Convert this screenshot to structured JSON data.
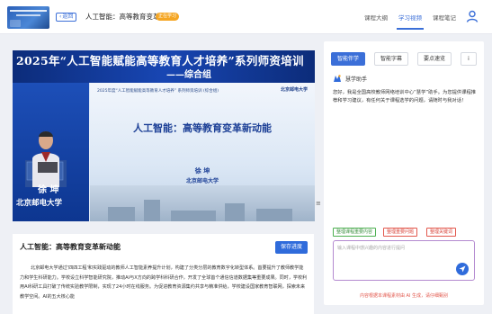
{
  "header": {
    "back_label": "返回",
    "course_title": "人工智能：高等教育变革...",
    "status": "正在学习",
    "tabs": [
      {
        "label": "课程大纲",
        "active": false
      },
      {
        "label": "学习视频",
        "active": true
      },
      {
        "label": "课程笔记",
        "active": false
      }
    ],
    "accent_color": "#3b6fd8"
  },
  "video": {
    "banner_title": "2025年“人工智能赋能高等教育人才培养”系列师资培训",
    "banner_subtitle": "——综合组",
    "speaker_name": "徐  坤",
    "speaker_org": "北京邮电大学",
    "slide_header": "2025年度“人工智能赋能高等教育人才培养” 系列师资培训 (综合组)",
    "slide_logo": "北京邮电大学",
    "slide_title": "人工智能：高等教育变革新动能",
    "slide_name": "徐  坤",
    "slide_org": "北京邮电大学"
  },
  "summary": {
    "title": "人工智能：高等教育变革新动能",
    "save_label": "保存进度",
    "text": "北京邮电大学通过'四四工程'和实践驱动的教师人工智能素养提升计划，构建了分类分层的教育数字化转型体系。首要提升了教师教学能力和学生科研能力。学校设立科学智能研究院，推动AI与X方向的跨学科科研合作，开发了全球首个通信信道数据集等重要成果。同时，学校利用AI科研工具打破了传统实验教学限制，实现了24小时在线服务。为促进教育资源集约共享与精准供给，学校建设国家教育智联网，探索未来教学空间。AI的五大核心能"
  },
  "ai_panel": {
    "tabs": [
      {
        "label": "智能伴学",
        "active": true
      },
      {
        "label": "智能字幕",
        "active": false
      },
      {
        "label": "要点速览",
        "active": false
      },
      {
        "label": "i",
        "active": false
      }
    ],
    "assistant_name": "慧学助手",
    "message": "您好，我是全国高校教师网络培训中心“慧学”助手。为您提供课程推荐和学习建议，有任何关于课程选学的问题，请随时与我对话！",
    "chips": [
      {
        "label": "整理课程重要内容",
        "color": "green"
      },
      {
        "label": "整理重要问题",
        "color": "red"
      },
      {
        "label": "整理关键词",
        "color": "red"
      }
    ],
    "input_placeholder": "输入课程中感兴趣的内容进行提问",
    "disclaimer": "内容根据本课程素材由 AI 生成，请仔细甄别"
  }
}
